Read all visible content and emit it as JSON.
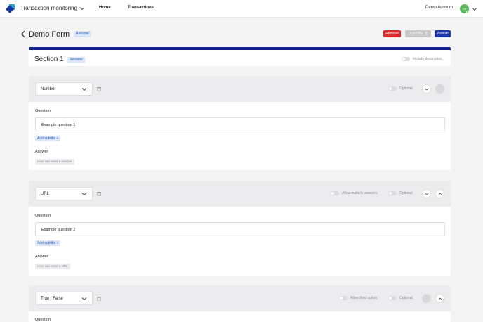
{
  "nav": {
    "app_title": "Transaction monitoring",
    "home": "Home",
    "transactions": "Transactions",
    "account": "Demo Account",
    "avatar_initials": "DA"
  },
  "header": {
    "title": "Demo Form",
    "rename": "Rename",
    "remove": "Remove",
    "duplicate": "Duplicate",
    "publish": "Publish"
  },
  "section": {
    "title": "Section 1",
    "rename": "Rename",
    "include_description": "Include description"
  },
  "questions": [
    {
      "type": "Number",
      "optional": "Optional",
      "question_label": "Question",
      "question_value": "Example question 1",
      "add_subtitle": "Add subtitle +",
      "answer_label": "Answer",
      "answer_hint": "User can enter a number"
    },
    {
      "type": "URL",
      "extra_toggle": "Allow multiple answers",
      "optional": "Optional",
      "question_label": "Question",
      "question_value": "Example question 2",
      "add_subtitle": "Add subtitle +",
      "answer_label": "Answer",
      "answer_hint": "User can enter a URL"
    },
    {
      "type": "True / False",
      "extra_toggle": "Allow third option",
      "optional": "Optional",
      "question_label": "Question"
    }
  ],
  "colors": {
    "primary": "#14248a",
    "remove": "#d92b2b",
    "badge_bg": "#dbe6f7",
    "avatar": "#5bb85b"
  }
}
